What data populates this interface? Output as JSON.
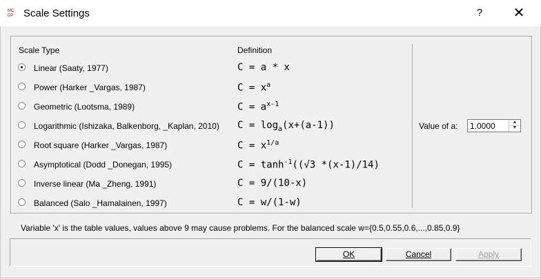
{
  "window": {
    "title": "Scale Settings",
    "help_label": "?",
    "close_label": "✕"
  },
  "table": {
    "col_scale_type": "Scale Type",
    "col_definition": "Definition",
    "rows": [
      {
        "label": "Linear (Saaty, 1977)",
        "checked": true
      },
      {
        "label": "Power (Harker _Vargas, 1987)",
        "checked": false
      },
      {
        "label": "Geometric (Lootsma, 1989)",
        "checked": false
      },
      {
        "label": "Logarithmic (Ishizaka, Balkenborg, _Kaplan, 2010)",
        "checked": false
      },
      {
        "label": "Root square (Harker _Vargas, 1987)",
        "checked": false
      },
      {
        "label": "Asymptotical (Dodd _Donegan, 1995)",
        "checked": false
      },
      {
        "label": "Inverse linear (Ma _Zheng, 1991)",
        "checked": false
      },
      {
        "label": "Balanced (Salo _Hamalainen, 1997)",
        "checked": false
      }
    ],
    "formulas": {
      "f0": "C = a * x",
      "f1_base": "C = x",
      "f1_sup": "a",
      "f2_base": "C = a",
      "f2_sup": "x-1",
      "f3_pre": "C = log",
      "f3_sub": "a",
      "f3_post": "(x+(a-1))",
      "f4_base": "C = x",
      "f4_sup": "1/a",
      "f5_pre": "C = tanh",
      "f5_sup": "-1",
      "f5_post": "((√3 *(x-1)/14)",
      "f6": "C = 9/(10-x)",
      "f7": "C = w/(1-w)"
    }
  },
  "value": {
    "label": "Value of a:",
    "input": "1.0000"
  },
  "note": "Variable 'x' is the table values, values above 9 may cause problems. For the balanced scale w={0.5,0.55,0.6,...,0.85,0.9}",
  "buttons": {
    "ok": "OK",
    "cancel": "Cancel",
    "apply": "Apply"
  }
}
